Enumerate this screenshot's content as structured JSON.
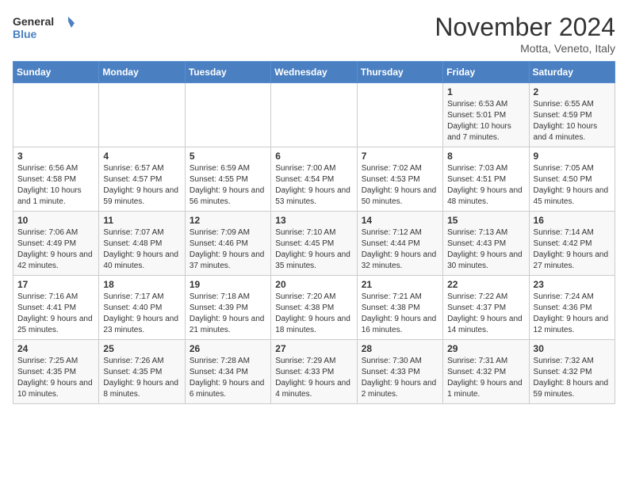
{
  "header": {
    "logo_line1": "General",
    "logo_line2": "Blue",
    "month": "November 2024",
    "location": "Motta, Veneto, Italy"
  },
  "days_of_week": [
    "Sunday",
    "Monday",
    "Tuesday",
    "Wednesday",
    "Thursday",
    "Friday",
    "Saturday"
  ],
  "weeks": [
    [
      {
        "day": "",
        "info": ""
      },
      {
        "day": "",
        "info": ""
      },
      {
        "day": "",
        "info": ""
      },
      {
        "day": "",
        "info": ""
      },
      {
        "day": "",
        "info": ""
      },
      {
        "day": "1",
        "info": "Sunrise: 6:53 AM\nSunset: 5:01 PM\nDaylight: 10 hours and 7 minutes."
      },
      {
        "day": "2",
        "info": "Sunrise: 6:55 AM\nSunset: 4:59 PM\nDaylight: 10 hours and 4 minutes."
      }
    ],
    [
      {
        "day": "3",
        "info": "Sunrise: 6:56 AM\nSunset: 4:58 PM\nDaylight: 10 hours and 1 minute."
      },
      {
        "day": "4",
        "info": "Sunrise: 6:57 AM\nSunset: 4:57 PM\nDaylight: 9 hours and 59 minutes."
      },
      {
        "day": "5",
        "info": "Sunrise: 6:59 AM\nSunset: 4:55 PM\nDaylight: 9 hours and 56 minutes."
      },
      {
        "day": "6",
        "info": "Sunrise: 7:00 AM\nSunset: 4:54 PM\nDaylight: 9 hours and 53 minutes."
      },
      {
        "day": "7",
        "info": "Sunrise: 7:02 AM\nSunset: 4:53 PM\nDaylight: 9 hours and 50 minutes."
      },
      {
        "day": "8",
        "info": "Sunrise: 7:03 AM\nSunset: 4:51 PM\nDaylight: 9 hours and 48 minutes."
      },
      {
        "day": "9",
        "info": "Sunrise: 7:05 AM\nSunset: 4:50 PM\nDaylight: 9 hours and 45 minutes."
      }
    ],
    [
      {
        "day": "10",
        "info": "Sunrise: 7:06 AM\nSunset: 4:49 PM\nDaylight: 9 hours and 42 minutes."
      },
      {
        "day": "11",
        "info": "Sunrise: 7:07 AM\nSunset: 4:48 PM\nDaylight: 9 hours and 40 minutes."
      },
      {
        "day": "12",
        "info": "Sunrise: 7:09 AM\nSunset: 4:46 PM\nDaylight: 9 hours and 37 minutes."
      },
      {
        "day": "13",
        "info": "Sunrise: 7:10 AM\nSunset: 4:45 PM\nDaylight: 9 hours and 35 minutes."
      },
      {
        "day": "14",
        "info": "Sunrise: 7:12 AM\nSunset: 4:44 PM\nDaylight: 9 hours and 32 minutes."
      },
      {
        "day": "15",
        "info": "Sunrise: 7:13 AM\nSunset: 4:43 PM\nDaylight: 9 hours and 30 minutes."
      },
      {
        "day": "16",
        "info": "Sunrise: 7:14 AM\nSunset: 4:42 PM\nDaylight: 9 hours and 27 minutes."
      }
    ],
    [
      {
        "day": "17",
        "info": "Sunrise: 7:16 AM\nSunset: 4:41 PM\nDaylight: 9 hours and 25 minutes."
      },
      {
        "day": "18",
        "info": "Sunrise: 7:17 AM\nSunset: 4:40 PM\nDaylight: 9 hours and 23 minutes."
      },
      {
        "day": "19",
        "info": "Sunrise: 7:18 AM\nSunset: 4:39 PM\nDaylight: 9 hours and 21 minutes."
      },
      {
        "day": "20",
        "info": "Sunrise: 7:20 AM\nSunset: 4:38 PM\nDaylight: 9 hours and 18 minutes."
      },
      {
        "day": "21",
        "info": "Sunrise: 7:21 AM\nSunset: 4:38 PM\nDaylight: 9 hours and 16 minutes."
      },
      {
        "day": "22",
        "info": "Sunrise: 7:22 AM\nSunset: 4:37 PM\nDaylight: 9 hours and 14 minutes."
      },
      {
        "day": "23",
        "info": "Sunrise: 7:24 AM\nSunset: 4:36 PM\nDaylight: 9 hours and 12 minutes."
      }
    ],
    [
      {
        "day": "24",
        "info": "Sunrise: 7:25 AM\nSunset: 4:35 PM\nDaylight: 9 hours and 10 minutes."
      },
      {
        "day": "25",
        "info": "Sunrise: 7:26 AM\nSunset: 4:35 PM\nDaylight: 9 hours and 8 minutes."
      },
      {
        "day": "26",
        "info": "Sunrise: 7:28 AM\nSunset: 4:34 PM\nDaylight: 9 hours and 6 minutes."
      },
      {
        "day": "27",
        "info": "Sunrise: 7:29 AM\nSunset: 4:33 PM\nDaylight: 9 hours and 4 minutes."
      },
      {
        "day": "28",
        "info": "Sunrise: 7:30 AM\nSunset: 4:33 PM\nDaylight: 9 hours and 2 minutes."
      },
      {
        "day": "29",
        "info": "Sunrise: 7:31 AM\nSunset: 4:32 PM\nDaylight: 9 hours and 1 minute."
      },
      {
        "day": "30",
        "info": "Sunrise: 7:32 AM\nSunset: 4:32 PM\nDaylight: 8 hours and 59 minutes."
      }
    ]
  ]
}
